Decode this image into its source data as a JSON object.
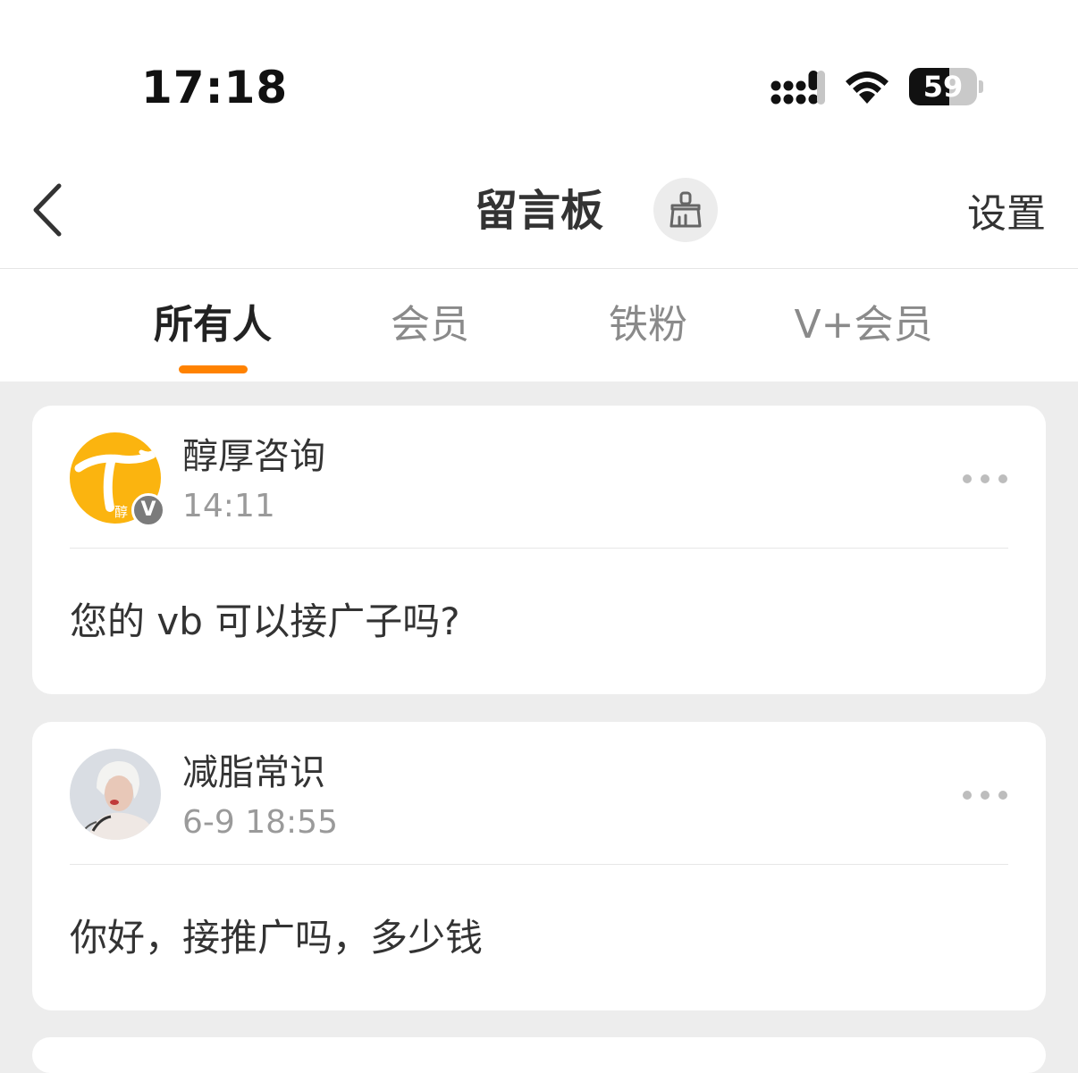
{
  "status_bar": {
    "time": "17:18",
    "battery_percent": "59",
    "battery_level": 0.59
  },
  "nav": {
    "title": "留言板",
    "settings_label": "设置"
  },
  "tabs": [
    {
      "label": "所有人",
      "active": true
    },
    {
      "label": "会员",
      "active": false
    },
    {
      "label": "铁粉",
      "active": false
    },
    {
      "label": "V+会员",
      "active": false
    }
  ],
  "messages": [
    {
      "username": "醇厚咨询",
      "time": "14:11",
      "text": "您的 vb 可以接广子吗?",
      "avatar_text": "醇",
      "verified_label": "V",
      "avatar_color": "#fbb40f"
    },
    {
      "username": "减脂常识",
      "time": "6-9 18:55",
      "text": "你好，接推广吗，多少钱",
      "avatar_color": "#d9dde3"
    }
  ],
  "colors": {
    "accent": "#ff8200",
    "background": "#ededed"
  }
}
